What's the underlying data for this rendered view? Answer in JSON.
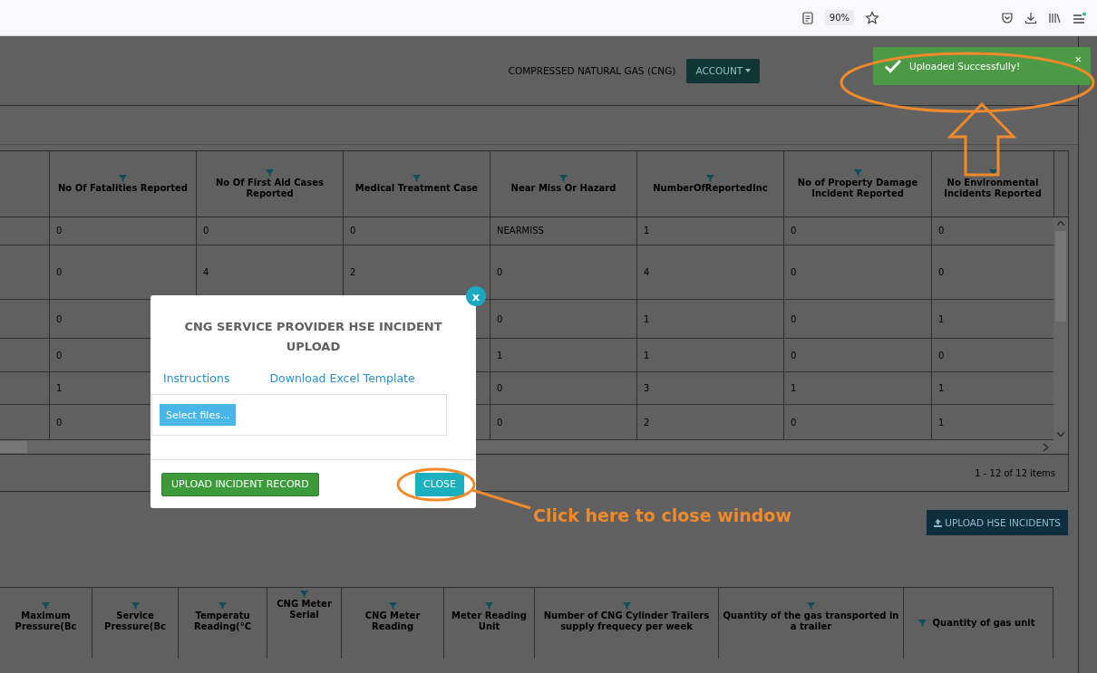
{
  "browser_toolbar": {
    "zoom": "90%"
  },
  "header": {
    "title": "COMPRESSED NATURAL GAS (CNG)",
    "account_button": "ACCOUNT"
  },
  "toast": {
    "message": "Uploaded Successfully!",
    "close": "×"
  },
  "incidents_table": {
    "columns": [
      "No Of Fatalities Reported",
      "No Of First Aid Cases Reported",
      "Medical Treatment Case",
      "Near Miss Or Hazard",
      "NumberOfReportedInc",
      "No of Property Damage Incident Reported",
      "No Environmental Incidents Reported"
    ],
    "rows": [
      {
        "cells": [
          "0",
          "0",
          "0",
          "NEARMISS",
          "1",
          "0",
          "0"
        ]
      },
      {
        "cells": [
          "0",
          "4",
          "2",
          "0",
          "4",
          "0",
          "0"
        ]
      },
      {
        "cells": [
          "0",
          null,
          null,
          "0",
          "1",
          "0",
          "1"
        ]
      },
      {
        "cells": [
          "0",
          null,
          null,
          "1",
          "1",
          "0",
          "0"
        ]
      },
      {
        "cells": [
          "1",
          null,
          null,
          "0",
          "3",
          "1",
          "1"
        ]
      },
      {
        "cells": [
          "0",
          null,
          null,
          "0",
          "2",
          "0",
          "1"
        ]
      }
    ],
    "pager": "1 - 12 of 12 items"
  },
  "upload_hse_button": "UPLOAD HSE INCIDENTS",
  "cylinders_table": {
    "columns": [
      "Maximum Pressure(Bc",
      "Service Pressure(Bc",
      "Temperatu Reading(°C",
      "CNG Meter Serial",
      "CNG Meter Reading",
      "Meter Reading Unit",
      "Number of CNG Cylinder Trailers supply frequecy per week",
      "Quantity of the gas transported in a trailer",
      "Quantity of gas unit"
    ]
  },
  "modal": {
    "title": "CNG SERVICE PROVIDER HSE INCIDENT UPLOAD",
    "close_icon": "x",
    "links": [
      "Instructions",
      "Download Excel Template"
    ],
    "select_button": "Select files...",
    "upload_button": "UPLOAD INCIDENT RECORD",
    "close_button": "CLOSE"
  },
  "annotation": {
    "text": "Click here to close window"
  }
}
